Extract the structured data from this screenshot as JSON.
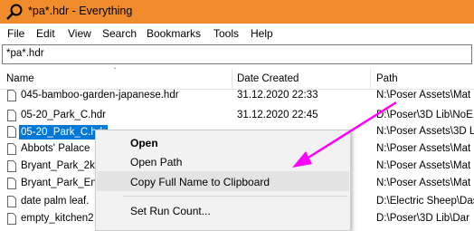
{
  "window": {
    "title": "*pa*.hdr - Everything"
  },
  "menu": [
    "File",
    "Edit",
    "View",
    "Search",
    "Bookmarks",
    "Tools",
    "Help"
  ],
  "search": {
    "value": "*pa*.hdr"
  },
  "columns": {
    "name": "Name",
    "date": "Date Created",
    "path": "Path"
  },
  "rows": [
    {
      "name": "045-bamboo-garden-japanese.hdr",
      "date": "31.12.2020 22:33",
      "path": "N:\\Poser Assets\\Mat"
    },
    {
      "name": "05-20_Park_C.hdr",
      "date": "31.12.2020 22:45",
      "path": "D:\\Poser\\3D Lib\\NoE"
    },
    {
      "name": "05-20_Park_C.hdr",
      "date": "",
      "path": "N:\\Poser Assets\\3D Li"
    },
    {
      "name": "Abbots' Palace",
      "date": "",
      "path": "N:\\Poser Assets\\Mat"
    },
    {
      "name": "Bryant_Park_2k.",
      "date": "",
      "path": "N:\\Poser Assets\\Mat"
    },
    {
      "name": "Bryant_Park_Ent",
      "date": "",
      "path": "N:\\Poser Assets\\Mat"
    },
    {
      "name": "date palm leaf.",
      "date": "",
      "path": "D:\\Electric Sheep\\Das"
    },
    {
      "name": "empty_kitchen2",
      "date": "",
      "path": "D:\\Poser\\3D Lib\\Dar"
    }
  ],
  "context_menu": {
    "items": [
      "Open",
      "Open Path",
      "Copy Full Name to Clipboard",
      "Set Run Count..."
    ]
  },
  "colors": {
    "titlebar": "#f08c2c",
    "selection": "#0078d7",
    "arrow": "#ff00ff"
  }
}
